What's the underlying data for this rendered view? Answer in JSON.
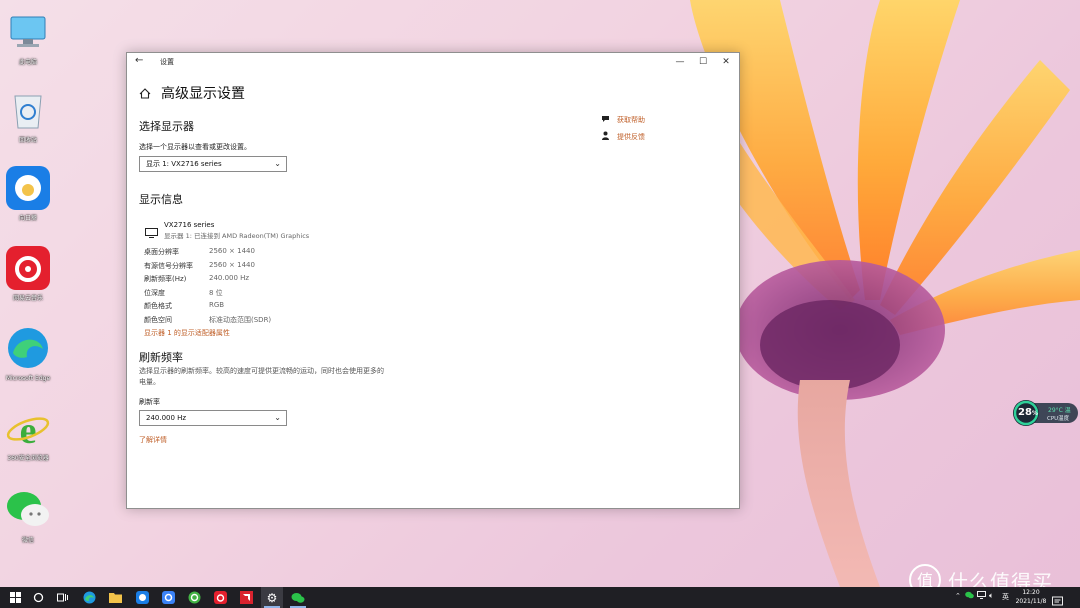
{
  "desktop": {
    "icons": [
      {
        "label": "此电脑",
        "icon": "computer-icon"
      },
      {
        "label": "回收站",
        "icon": "recycle-bin-icon"
      },
      {
        "label": "向日葵",
        "icon": "sunlogin-icon"
      },
      {
        "label": "网易云音乐",
        "icon": "netease-music-icon"
      },
      {
        "label": "Microsoft Edge",
        "icon": "edge-icon"
      },
      {
        "label": "360安全浏览器",
        "icon": "ie-360-icon"
      },
      {
        "label": "微信",
        "icon": "wechat-icon"
      }
    ]
  },
  "window": {
    "app_title": "设置",
    "back_glyph": "←",
    "controls": {
      "minimize": "—",
      "maximize": "☐",
      "close": "✕"
    },
    "page_title": "高级显示设置",
    "select_display": {
      "heading": "选择显示器",
      "description": "选择一个显示器以查看或更改设置。",
      "selected": "显示 1: VX2716 series"
    },
    "display_info": {
      "heading": "显示信息",
      "monitor_name": "VX2716 series",
      "monitor_connection": "显示器 1: 已连接到 AMD Radeon(TM) Graphics",
      "rows": [
        {
          "key": "桌面分辨率",
          "value": "2560 × 1440"
        },
        {
          "key": "有源信号分辨率",
          "value": "2560 × 1440"
        },
        {
          "key": "刷新频率(Hz)",
          "value": "240.000 Hz"
        },
        {
          "key": "位深度",
          "value": "8 位"
        },
        {
          "key": "颜色格式",
          "value": "RGB"
        },
        {
          "key": "颜色空间",
          "value": "标准动态范围(SDR)"
        }
      ],
      "adapter_link": "显示器 1 的显示适配器属性"
    },
    "refresh": {
      "heading": "刷新频率",
      "description": "选择显示器的刷新频率。较高的速度可提供更流畅的运动，同时也会使用更多的电量。",
      "label": "刷新率",
      "selected": "240.000 Hz",
      "learn_more": "了解详情"
    },
    "side_links": [
      {
        "label": "获取帮助",
        "icon": "help-icon"
      },
      {
        "label": "提供反馈",
        "icon": "feedback-icon"
      }
    ]
  },
  "cpu_widget": {
    "percent": "28",
    "percent_sign": "%",
    "temp": "29°C",
    "temp_suffix": "温",
    "label": "CPU温度"
  },
  "taskbar": {
    "items": [
      "start-icon",
      "search-icon",
      "task-view-icon",
      "edge-icon",
      "file-explorer-icon",
      "sunlogin-icon",
      "app-icon",
      "360-icon",
      "netease-music-icon",
      "amd-icon",
      "settings-icon",
      "wechat-icon"
    ],
    "clock_time": "12:20",
    "clock_date": "2021/11/8",
    "ime": "英"
  },
  "watermark": "什么值得买",
  "colors": {
    "accent_link": "#c0602a",
    "taskbar": "#1f1f24",
    "cpu_ring": "#2fd29a"
  }
}
